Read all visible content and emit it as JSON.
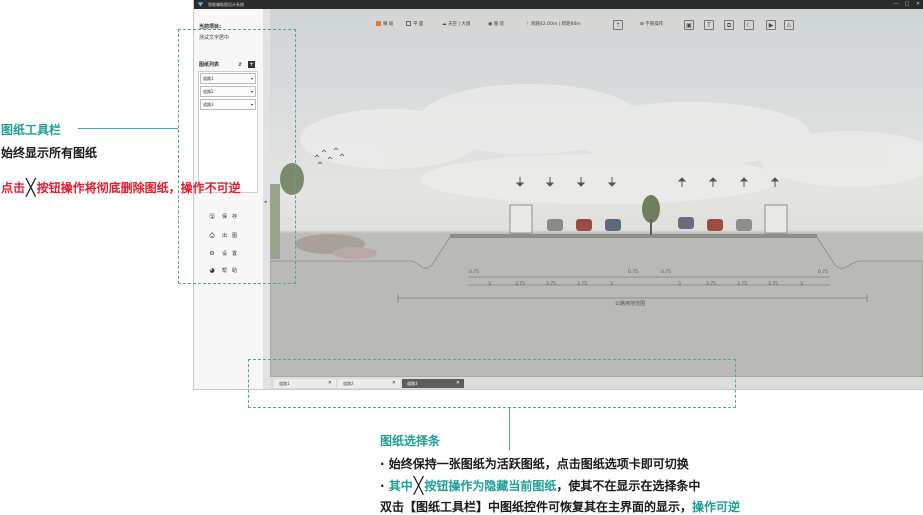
{
  "window": {
    "title": "智能辅助图设计系统",
    "controls": [
      "—",
      "□",
      "✕"
    ]
  },
  "left_panel": {
    "current_project_label": "当前项目:",
    "current_project_name": "测试文字居中",
    "drawing_list_label": "图纸列表",
    "sort_glyph": "⇵",
    "add_glyph": "+",
    "items": [
      {
        "label": "道路1",
        "arrow": "▾"
      },
      {
        "label": "道路2",
        "arrow": "▾"
      },
      {
        "label": "道路3",
        "arrow": "▾"
      }
    ],
    "actions": [
      {
        "icon": "🖫",
        "label": "保　存"
      },
      {
        "icon": "⎙",
        "label": "出　图"
      },
      {
        "icon": "⚙",
        "label": "设　置"
      },
      {
        "icon": "◕",
        "label": "帮　助"
      }
    ],
    "collapse_glyph": "◂"
  },
  "toolbar": {
    "view_cross": "横 坡",
    "view_plan": "平 面",
    "weather": "天空 | 大雨",
    "pedestrian": "服 装",
    "scale": "跨越42.00m | 跨距60m",
    "up_glyph": "⇡",
    "not_operate": "不限操作",
    "icons": [
      "▣",
      "T",
      "⧉",
      "☾",
      "▶",
      "⚠"
    ]
  },
  "canvas": {
    "dims_top": [
      "0.75",
      "0.75",
      "0.75",
      "0.75"
    ],
    "dims_bottom": [
      "3",
      "3.75",
      "3.75",
      "3.75",
      "3",
      "3",
      "3.75",
      "3.75",
      "3.75",
      "3"
    ],
    "range_label": "公路用地范围"
  },
  "tabs": [
    {
      "label": "道路1",
      "close": "✕"
    },
    {
      "label": "道路2",
      "close": "✕"
    },
    {
      "label": "道路3",
      "close": "✕"
    }
  ],
  "annotations": {
    "toolbar_title": "图纸工具栏",
    "toolbar_line1": "始终显示所有图纸",
    "toolbar_line2_a": "点击",
    "x_glyph": "╳",
    "toolbar_line2_b": "按钮操作将彻底删除图纸，操作不可逆",
    "tabs_title": "图纸选择条",
    "tabs_line1": "· 始终保持一张图纸为活跃图纸，点击图纸选项卡即可切换",
    "tabs_line2_dot": "· ",
    "tabs_line2_a": "其中",
    "tabs_line2_b": "按钮操作为隐藏当前图纸",
    "tabs_line2_c": "，使其不在显示在选择条中",
    "tabs_line3_a": "双击【图纸工具栏】中图纸控件可恢复其在主界面的显示，",
    "tabs_line3_b": "操作可逆"
  },
  "colors": {
    "annotation_teal": "#1f9f95",
    "warning_red": "#e02030",
    "active_tab": "#5c5c5c",
    "view_checked": "#e07b2c"
  }
}
